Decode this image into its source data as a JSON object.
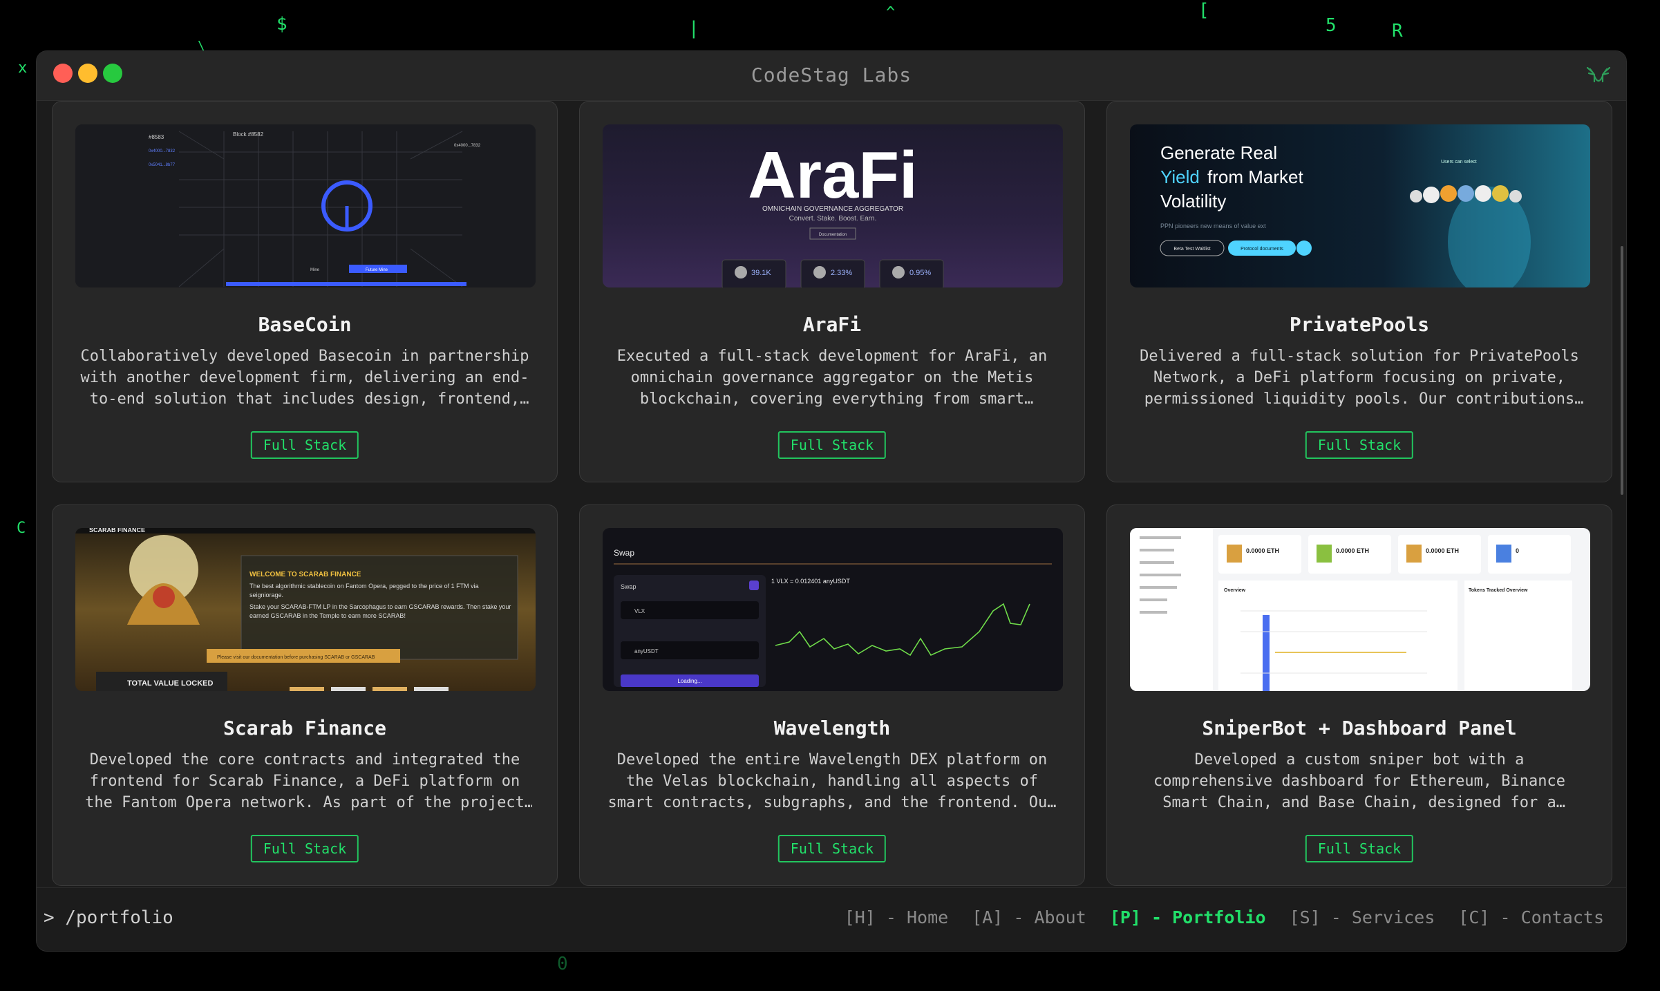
{
  "background": {
    "rain_chars": [
      "$",
      "x",
      "|",
      "^",
      "[",
      "5",
      "R",
      "C",
      "0",
      "\\"
    ]
  },
  "window": {
    "title": "CodeStag Labs",
    "logo_icon": "stag-icon"
  },
  "projects": [
    {
      "title": "BaseCoin",
      "description": "Collaboratively developed Basecoin in partnership with another development firm, delivering an end-to-end solution that includes design, frontend, backend and smart contracts.",
      "tag": "Full Stack",
      "preview": {
        "block_left": "#8583",
        "block_center": "Block #8582",
        "btn_mine": "Mine",
        "btn_future": "Future Mine"
      }
    },
    {
      "title": "AraFi",
      "description": "Executed a full-stack development for AraFi, an omnichain governance aggregator on the Metis blockchain, covering everything from smart contracts to the frontend.",
      "tag": "Full Stack",
      "preview": {
        "brand": "AraFi",
        "subtitle": "OMNICHAIN GOVERNANCE AGGREGATOR",
        "tagline": "Convert. Stake. Boost. Earn.",
        "doc_button": "Documentation",
        "stats": [
          "39.1K",
          "2.33%",
          "0.95%"
        ]
      }
    },
    {
      "title": "PrivatePools",
      "description": "Delivered a full-stack solution for PrivatePools Network, a DeFi platform focusing on private, permissioned liquidity pools. Our contributions covered smart contracts and the frontend.",
      "tag": "Full Stack",
      "preview": {
        "headline_1": "Generate Real",
        "headline_accent": "Yield",
        "headline_2": "from Market",
        "headline_3": "Volatility",
        "sub": "PPN pioneers new means of value ext",
        "btn_1": "Beta Test Waitlist",
        "btn_2": "Protocol documents",
        "users_label": "Users can select"
      }
    },
    {
      "title": "Scarab Finance",
      "description": "Developed the core contracts and integrated the frontend for Scarab Finance, a DeFi platform on the Fantom Opera network. As part of the project we built the staking mechanics.",
      "tag": "Full Stack",
      "preview": {
        "brand": "SCARAB FINANCE",
        "welcome": "WELCOME TO SCARAB FINANCE",
        "line_1": "The best algorithmic stablecoin on Fantom Opera, pegged to the price of 1 FTM via seigniorage.",
        "line_2": "Stake your SCARAB-FTM LP in the Sarcophagus to earn GSCARAB rewards. Then stake your earned GSCARAB in the Temple to earn more SCARAB!",
        "warning": "Please visit our documentation before purchasing SCARAB or GSCARAB",
        "tvl": "TOTAL VALUE LOCKED"
      }
    },
    {
      "title": "Wavelength",
      "description": "Developed the entire Wavelength DEX platform on the Velas blockchain, handling all aspects of smart contracts, subgraphs, and the frontend. Our team delivered the full DEX.",
      "tag": "Full Stack",
      "preview": {
        "heading": "Swap",
        "panel": "Swap",
        "token_from": "VLX",
        "token_to": "anyUSDT",
        "rate": "1 VLX = 0.012401 anyUSDT",
        "loading": "Loading..."
      }
    },
    {
      "title": "SniperBot + Dashboard Panel",
      "description": "Developed a custom sniper bot with a comprehensive dashboard for Ethereum, Binance Smart Chain, and Base Chain, designed for a private client. This bot tracks new tokens.",
      "tag": "Full Stack",
      "preview": {
        "stats": [
          "0.0000 ETH",
          "0.0000 ETH",
          "0.0000 ETH",
          "0"
        ],
        "overview": "Overview",
        "tracked": "Tokens Tracked Overview"
      }
    }
  ],
  "statusbar": {
    "prompt": "> /portfolio",
    "nav": [
      {
        "label": "[H] - Home",
        "active": false
      },
      {
        "label": "[A] - About",
        "active": false
      },
      {
        "label": "[P] - Portfolio",
        "active": true
      },
      {
        "label": "[S] - Services",
        "active": false
      },
      {
        "label": "[C] - Contacts",
        "active": false
      }
    ]
  },
  "colors": {
    "accent": "#22e06a",
    "window": "#1c1c1c",
    "card": "#272727"
  }
}
